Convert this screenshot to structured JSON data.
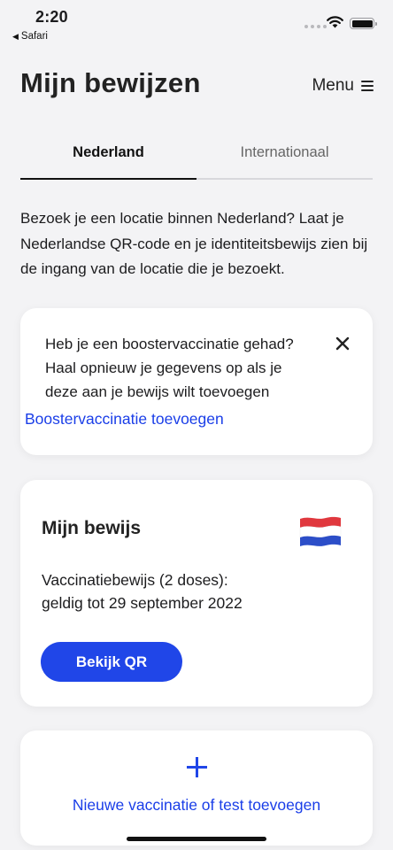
{
  "status_bar": {
    "time": "2:20",
    "back_app": "Safari",
    "back_arrow": "◀"
  },
  "header": {
    "title": "Mijn bewijzen",
    "menu_label": "Menu"
  },
  "tabs": [
    {
      "label": "Nederland",
      "active": true
    },
    {
      "label": "Internationaal",
      "active": false
    }
  ],
  "intro_text": "Bezoek je een locatie binnen Nederland? Laat je Nederlandse QR-code en je identiteitsbewijs zien bij de ingang van de locatie die je bezoekt.",
  "booster": {
    "text": "Heb je een boostervaccinatie gehad? Haal opnieuw je gegevens op als je deze aan je bewijs wilt toevoegen",
    "link": "Boostervaccinatie toevoegen"
  },
  "proof": {
    "title": "Mijn bewijs",
    "line1": "Vaccinatiebewijs (2 doses):",
    "line2": "geldig tot 29 september 2022",
    "button": "Bekijk QR"
  },
  "add_card": {
    "label": "Nieuwe vaccinatie of test toevoegen"
  },
  "colors": {
    "accent": "#2046e8",
    "link": "#1a3ee8",
    "flag_red": "#e0383e",
    "flag_blue": "#2c4ec8"
  }
}
